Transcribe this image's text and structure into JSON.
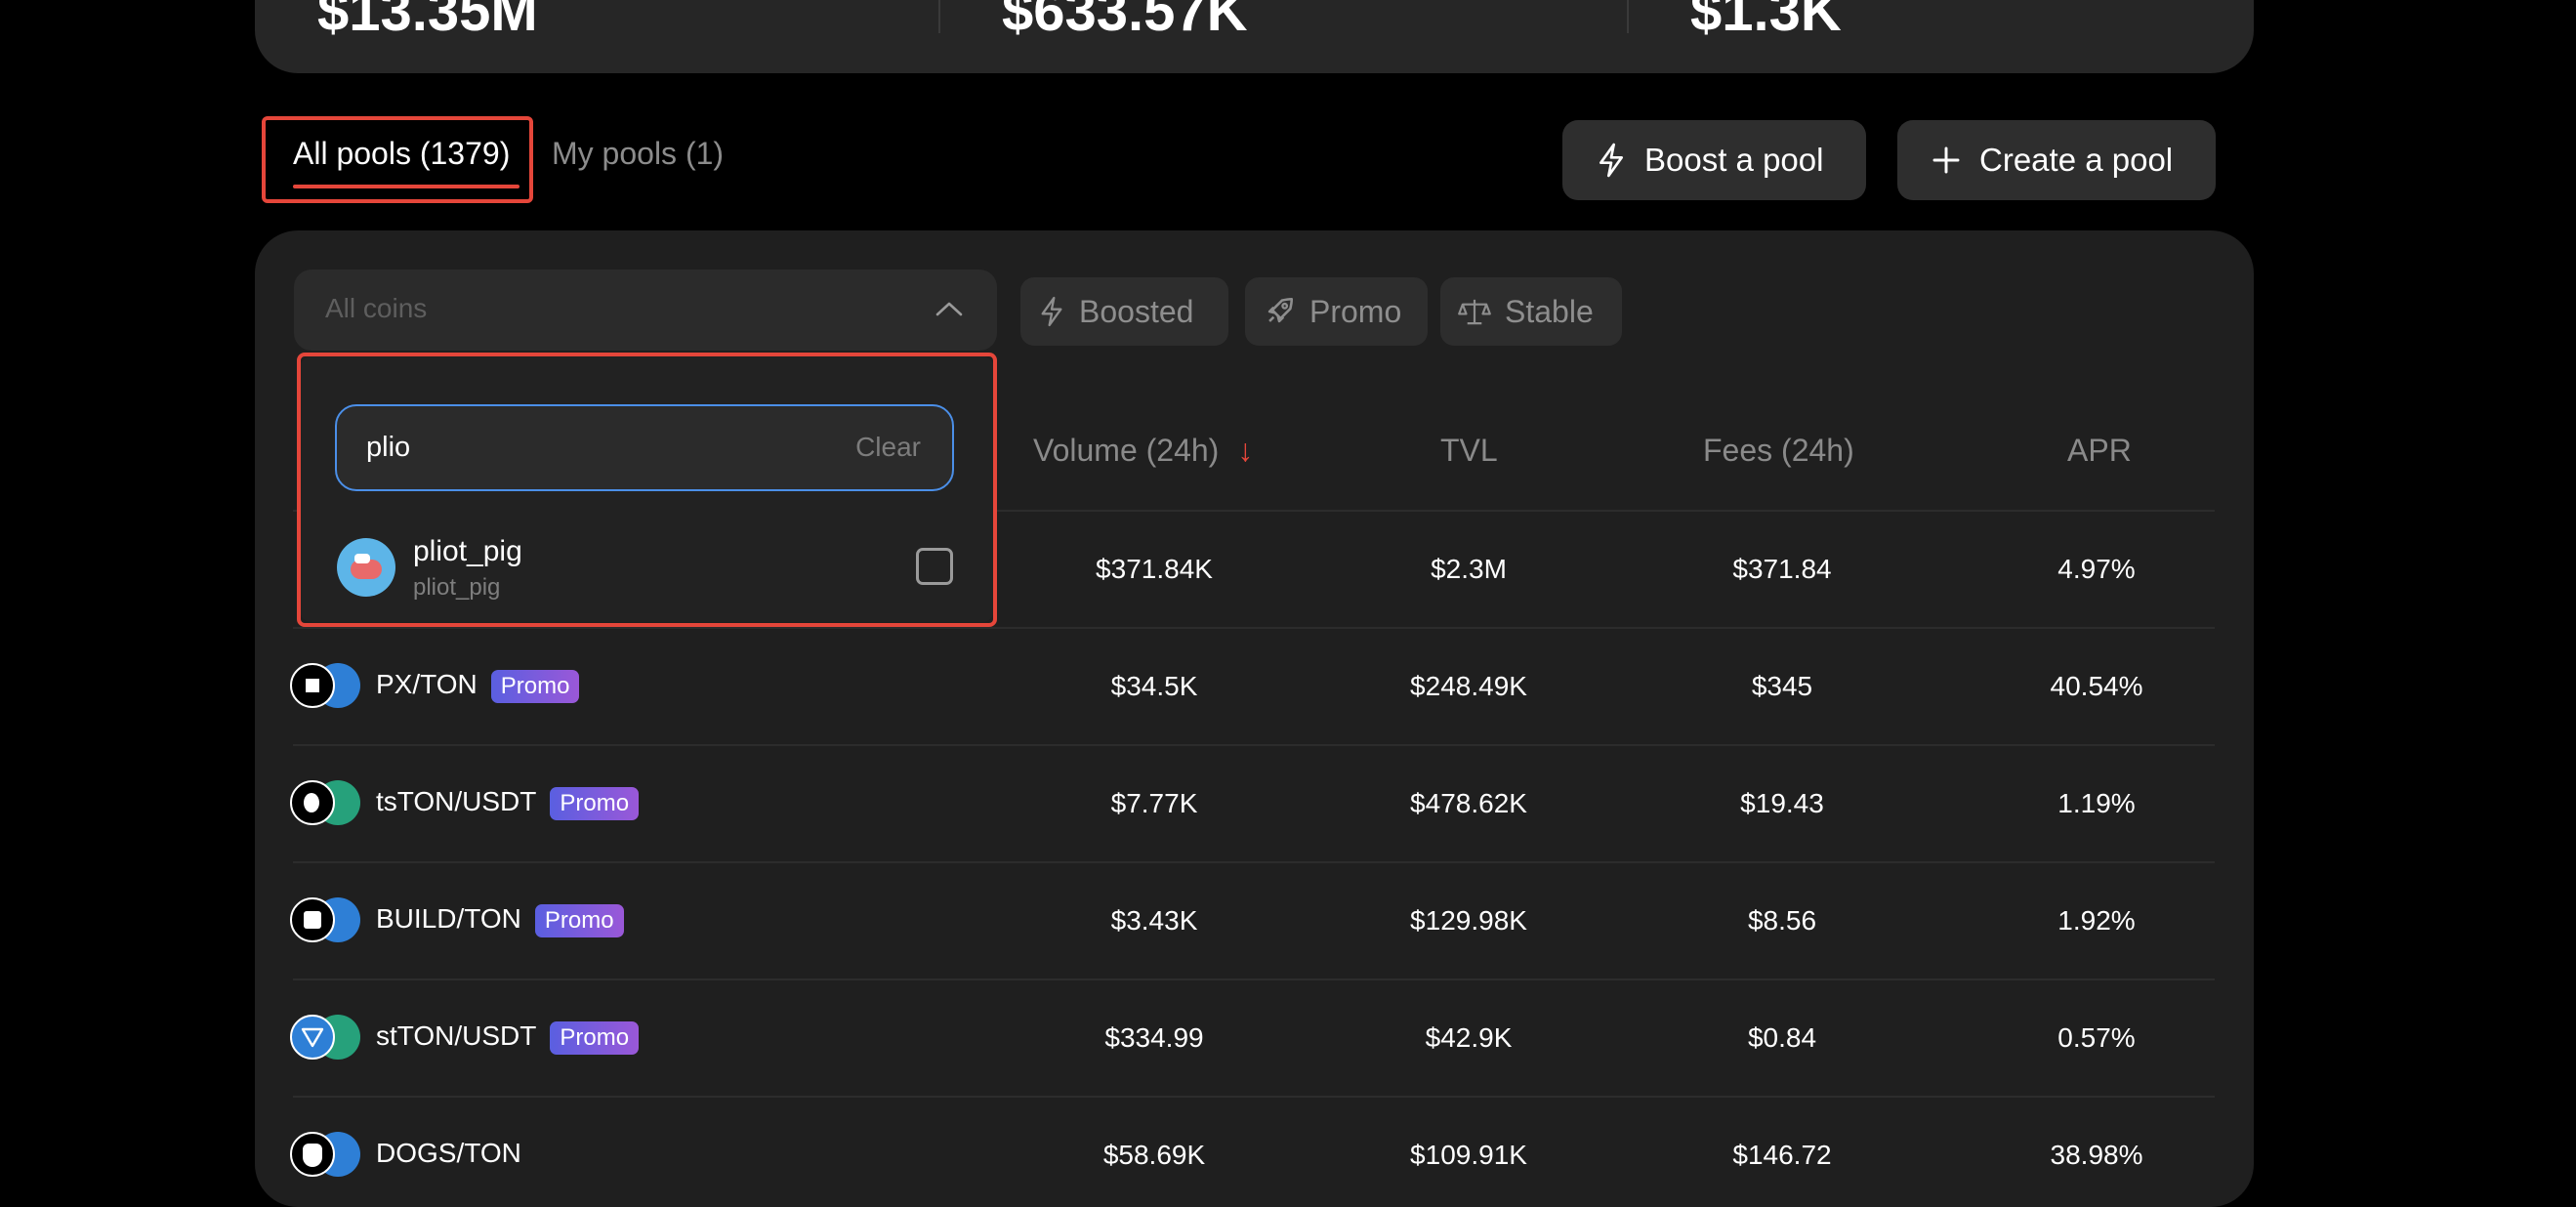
{
  "stats": [
    "$13.35M",
    "$633.57K",
    "$1.3K"
  ],
  "tabs": {
    "all": "All pools (1379)",
    "mine": "My pools (1)"
  },
  "actions": {
    "boost": "Boost a pool",
    "create": "Create a pool"
  },
  "filters": {
    "coin_placeholder": "All coins",
    "chips": [
      "Boosted",
      "Promo",
      "Stable"
    ]
  },
  "table": {
    "headers": {
      "volume": "Volume (24h)",
      "tvl": "TVL",
      "fees": "Fees (24h)",
      "apr": "APR"
    },
    "sort_arrow": "↓",
    "rows": [
      {
        "pair": "",
        "promo": "",
        "volume": "$371.84K",
        "tvl": "$2.3M",
        "fees": "$371.84",
        "apr": "4.97%"
      },
      {
        "pair": "PX/TON",
        "promo": "Promo",
        "volume": "$34.5K",
        "tvl": "$248.49K",
        "fees": "$345",
        "apr": "40.54%"
      },
      {
        "pair": "tsTON/USDT",
        "promo": "Promo",
        "volume": "$7.77K",
        "tvl": "$478.62K",
        "fees": "$19.43",
        "apr": "1.19%"
      },
      {
        "pair": "BUILD/TON",
        "promo": "Promo",
        "volume": "$3.43K",
        "tvl": "$129.98K",
        "fees": "$8.56",
        "apr": "1.92%"
      },
      {
        "pair": "stTON/USDT",
        "promo": "Promo",
        "volume": "$334.99",
        "tvl": "$42.9K",
        "fees": "$0.84",
        "apr": "0.57%"
      },
      {
        "pair": "DOGS/TON",
        "promo": "",
        "volume": "$58.69K",
        "tvl": "$109.91K",
        "fees": "$146.72",
        "apr": "38.98%"
      }
    ]
  },
  "dropdown": {
    "search_value": "plio",
    "clear_label": "Clear",
    "option": {
      "name": "pliot_pig",
      "sub": "pliot_pig"
    }
  },
  "colors": {
    "accent": "#e5463a",
    "focus": "#4b8fe8",
    "promo_start": "#5a5fe0",
    "promo_end": "#9a58d8"
  }
}
